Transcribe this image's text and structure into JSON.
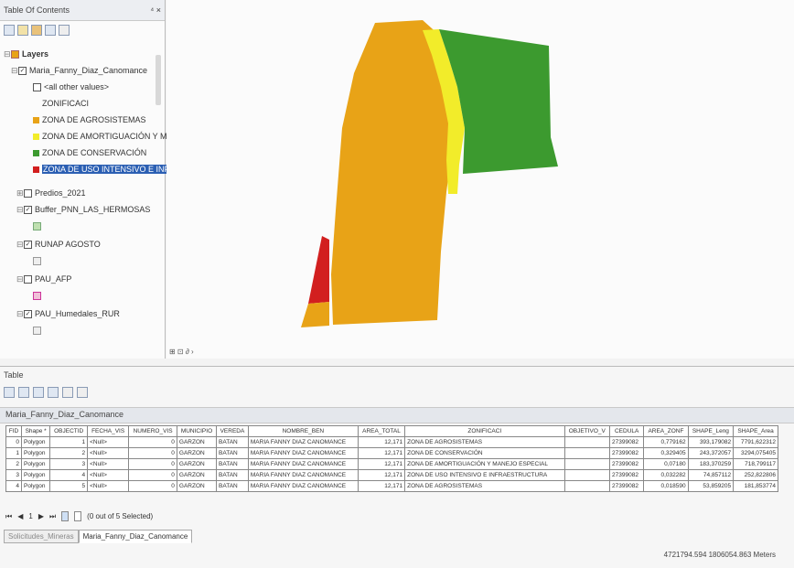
{
  "toc": {
    "title": "Table Of Contents",
    "pin": "⁴ ×",
    "layers_label": "Layers",
    "items": [
      {
        "label": "Maria_Fanny_Diaz_Canomance",
        "checked": true
      },
      {
        "label": "<all other values>"
      },
      {
        "label": "ZONIFICACI"
      },
      {
        "label": "ZONA DE AGROSISTEMAS",
        "color": "#e8a317"
      },
      {
        "label": "ZONA DE AMORTIGUACIÓN Y M",
        "color": "#f2ec2a"
      },
      {
        "label": "ZONA DE CONSERVACIÓN",
        "color": "#3c9a2f"
      },
      {
        "label": "ZONA DE USO INTENSIVO E INFR",
        "color": "#d21f1f"
      },
      {
        "label": "Predios_2021",
        "checked": false
      },
      {
        "label": "Buffer_PNN_LAS_HERMOSAS",
        "checked": true
      },
      {
        "label": "RUNAP AGOSTO",
        "checked": true
      },
      {
        "label": "PAU_AFP",
        "checked": false
      },
      {
        "label": "PAU_Humedales_RUR",
        "checked": true
      }
    ]
  },
  "map": {
    "status": "⊞ ⊡ ∂ ›"
  },
  "table": {
    "title": "Table",
    "layer_name": "Maria_Fanny_Diaz_Canomance",
    "columns": [
      "FID",
      "Shape *",
      "OBJECTID",
      "FECHA_VIS",
      "NUMERO_VIS",
      "MUNICIPIO",
      "VEREDA",
      "NOMBRE_BEN",
      "AREA_TOTAL",
      "ZONIFICACI",
      "OBJETIVO_V",
      "CEDULA",
      "AREA_ZONF",
      "SHAPE_Leng",
      "SHAPE_Area"
    ],
    "rows": [
      [
        "0",
        "Polygon",
        "1",
        "<Null>",
        "0",
        "GARZON",
        "BATAN",
        "MARIA FANNY DIAZ CANOMANCE",
        "12,171",
        "ZONA DE AGROSISTEMAS",
        "",
        "27399082",
        "0,779162",
        "393,179082",
        "7791,622312"
      ],
      [
        "1",
        "Polygon",
        "2",
        "<Null>",
        "0",
        "GARZON",
        "BATAN",
        "MARIA FANNY DIAZ CANOMANCE",
        "12,171",
        "ZONA DE CONSERVACIÓN",
        "",
        "27399082",
        "0,329405",
        "243,372057",
        "3294,075405"
      ],
      [
        "2",
        "Polygon",
        "3",
        "<Null>",
        "0",
        "GARZON",
        "BATAN",
        "MARIA FANNY DIAZ CANOMANCE",
        "12,171",
        "ZONA DE AMORTIGUACIÓN Y MANEJO ESPECIAL",
        "",
        "27399082",
        "0,07180",
        "183,370259",
        "718,799117"
      ],
      [
        "3",
        "Polygon",
        "4",
        "<Null>",
        "0",
        "GARZON",
        "BATAN",
        "MARIA FANNY DIAZ CANOMANCE",
        "12,171",
        "ZONA DE USO INTENSIVO E INFRAESTRUCTURA",
        "",
        "27399082",
        "0,032282",
        "74,857112",
        "252,822806"
      ],
      [
        "4",
        "Polygon",
        "5",
        "<Null>",
        "0",
        "GARZON",
        "BATAN",
        "MARIA FANNY DIAZ CANOMANCE",
        "12,171",
        "ZONA DE AGROSISTEMAS",
        "",
        "27399082",
        "0,018590",
        "53,859205",
        "181,853774"
      ]
    ],
    "record_current": "1",
    "selection_text": "(0 out of 5 Selected)",
    "tabs": [
      "Solicitudes_Mineras",
      "Maria_Fanny_Diaz_Canomance"
    ],
    "active_tab": 1
  },
  "status_bar": {
    "coordinates": "4721794.594  1806054.863 Meters"
  }
}
